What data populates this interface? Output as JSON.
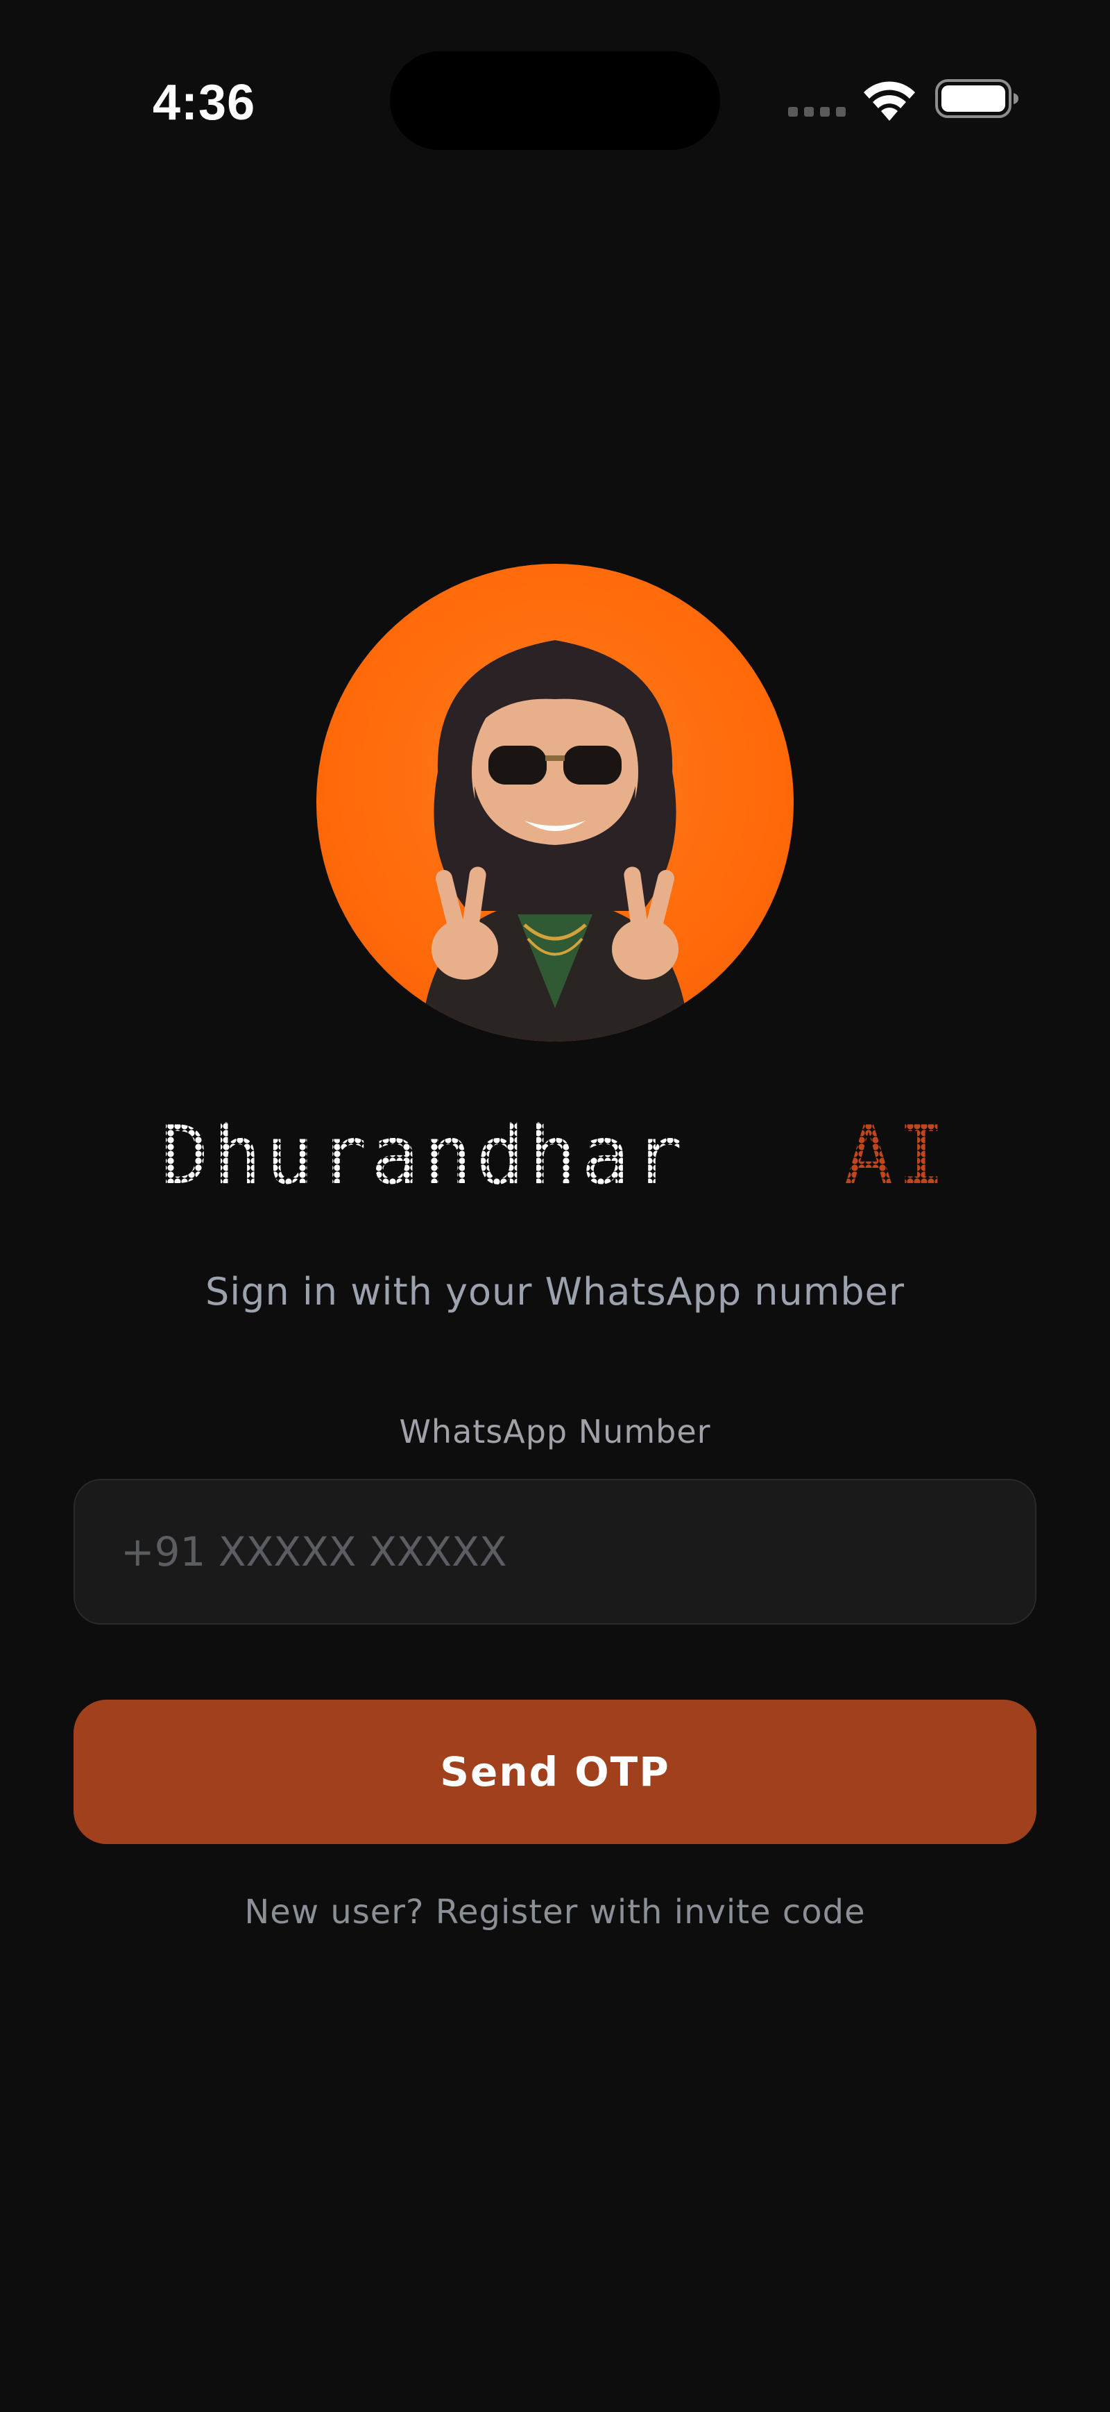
{
  "status_bar": {
    "time": "4:36",
    "icons": [
      "cellular-signal-icon",
      "wifi-icon",
      "battery-icon"
    ]
  },
  "avatar": {
    "icon": "avatar-icon",
    "background_color": "#ff6a0a"
  },
  "title": {
    "main": "Dhurandhar",
    "accent": "AI",
    "accent_color": "#c2461b"
  },
  "subtitle": "Sign in with your WhatsApp number",
  "form": {
    "field_label": "WhatsApp Number",
    "phone_placeholder": "+91 XXXXX XXXXX",
    "phone_value": "",
    "submit_label": "Send OTP",
    "submit_color": "#a0401c"
  },
  "register_link": "New user? Register with invite code"
}
